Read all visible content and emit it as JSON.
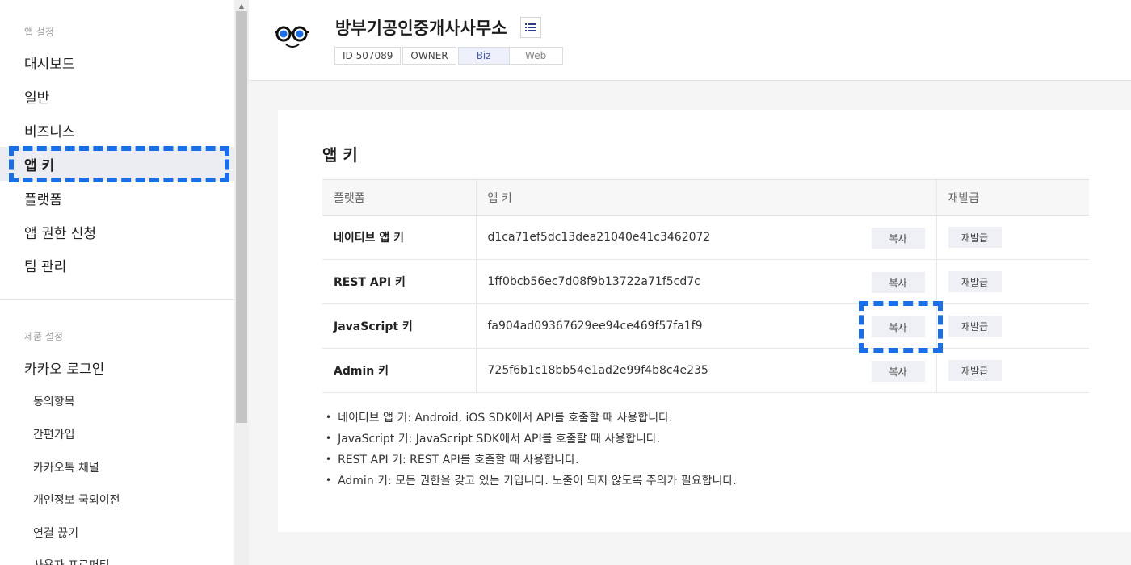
{
  "sidebar": {
    "app_settings_label": "앱 설정",
    "items": [
      {
        "label": "대시보드"
      },
      {
        "label": "일반"
      },
      {
        "label": "비즈니스"
      },
      {
        "label": "앱 키"
      },
      {
        "label": "플랫폼"
      },
      {
        "label": "앱 권한 신청"
      },
      {
        "label": "팀 관리"
      }
    ],
    "product_settings_label": "제품 설정",
    "product_items": [
      {
        "label": "카카오 로그인"
      }
    ],
    "sub_items": [
      {
        "label": "동의항목"
      },
      {
        "label": "간편가입"
      },
      {
        "label": "카카오톡 채널"
      },
      {
        "label": "개인정보 국외이전"
      },
      {
        "label": "연결 끊기"
      },
      {
        "label": "사용자 프로퍼티"
      }
    ]
  },
  "header": {
    "app_name": "방부기공인중개사사무소",
    "tags": {
      "id": "ID 507089",
      "role": "OWNER",
      "biz": "Biz",
      "web": "Web"
    }
  },
  "main": {
    "title": "앱 키",
    "columns": [
      "플랫폼",
      "앱 키",
      "재발급"
    ],
    "rows": [
      {
        "platform": "네이티브 앱 키",
        "key": "d1ca71ef5dc13dea21040e41c3462072",
        "copy": "복사",
        "reissue": "재발급"
      },
      {
        "platform": "REST API 키",
        "key": "1ff0bcb56ec7d08f9b13722a71f5cd7c",
        "copy": "복사",
        "reissue": "재발급"
      },
      {
        "platform": "JavaScript 키",
        "key": "fa904ad09367629ee94ce469f57fa1f9",
        "copy": "복사",
        "reissue": "재발급"
      },
      {
        "platform": "Admin 키",
        "key": "725f6b1c18bb54e1ad2e99f4b8c4e235",
        "copy": "복사",
        "reissue": "재발급"
      }
    ],
    "notes": [
      "네이티브 앱 키: Android, iOS SDK에서 API를 호출할 때 사용합니다.",
      "JavaScript 키: JavaScript SDK에서 API를 호출할 때 사용합니다.",
      "REST API 키: REST API를 호출할 때 사용합니다.",
      "Admin 키: 모든 권한을 갖고 있는 키입니다. 노출이 되지 않도록 주의가 필요합니다."
    ]
  },
  "colors": {
    "accent": "#1a6fe8",
    "active_bg": "#ebedf3"
  }
}
